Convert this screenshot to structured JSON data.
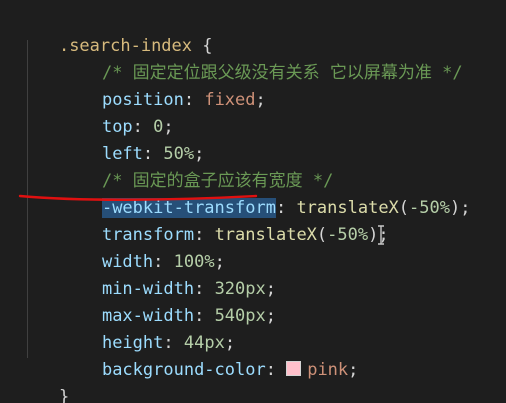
{
  "code": {
    "selector": ".search-index",
    "open_brace": "{",
    "close_brace": "}",
    "comment1": "/* 固定定位跟父级没有关系 它以屏幕为准 */",
    "comment2": "/* 固定的盒子应该有宽度 */",
    "lines": {
      "position": {
        "prop": "position",
        "value": "fixed"
      },
      "top": {
        "prop": "top",
        "num": "0"
      },
      "left": {
        "prop": "left",
        "num": "50",
        "unit": "%"
      },
      "webkit": {
        "prop": "-webkit-transform",
        "fn": "translateX",
        "num": "-50",
        "unit": "%"
      },
      "transform": {
        "prop": "transform",
        "fn": "translateX",
        "num": "-50",
        "unit": "%"
      },
      "width": {
        "prop": "width",
        "num": "100",
        "unit": "%"
      },
      "min_width": {
        "prop": "min-width",
        "num": "320",
        "unit": "px"
      },
      "max_width": {
        "prop": "max-width",
        "num": "540",
        "unit": "px"
      },
      "height": {
        "prop": "height",
        "num": "44",
        "unit": "px"
      },
      "bg": {
        "prop": "background-color",
        "value": "pink",
        "swatch_color": "#ffc0cb"
      }
    }
  },
  "colors": {
    "background": "#1e1e1e",
    "selection": "#264f78",
    "underline": "#e01010"
  }
}
